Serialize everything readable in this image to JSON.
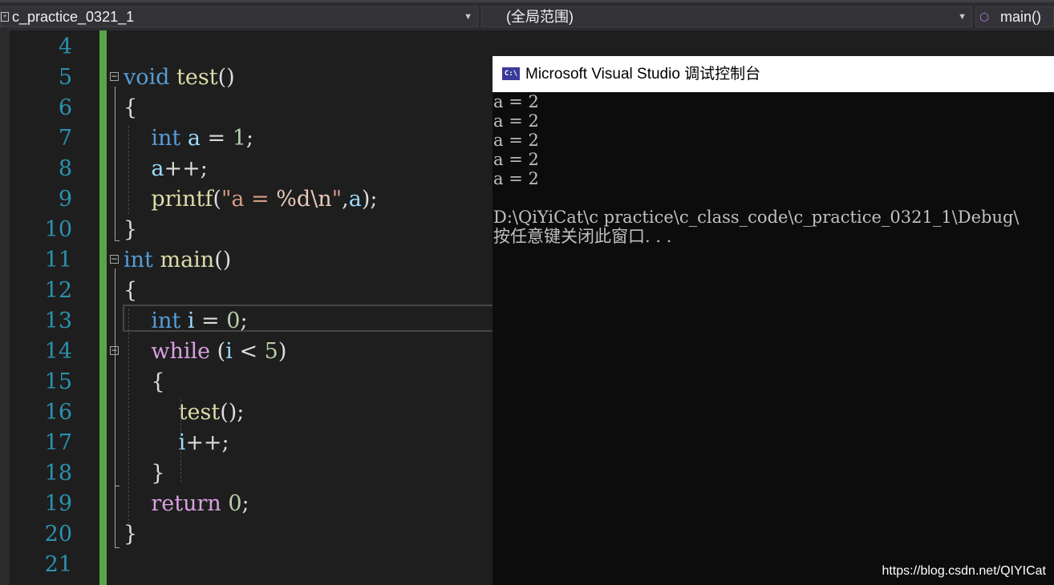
{
  "navbar": {
    "project": "c_practice_0321_1",
    "scope": "(全局范围)",
    "member": "main()"
  },
  "editor": {
    "lines": [
      {
        "num": "4"
      },
      {
        "num": "5",
        "tokens": [
          [
            "kw",
            "void"
          ],
          [
            "plain",
            " "
          ],
          [
            "fn",
            "test"
          ],
          [
            "plain",
            "()"
          ]
        ]
      },
      {
        "num": "6",
        "tokens": [
          [
            "plain",
            "{"
          ]
        ]
      },
      {
        "num": "7",
        "tokens": [
          [
            "plain",
            "    "
          ],
          [
            "kw",
            "int"
          ],
          [
            "plain",
            " "
          ],
          [
            "var",
            "a"
          ],
          [
            "plain",
            " = "
          ],
          [
            "num",
            "1"
          ],
          [
            "plain",
            ";"
          ]
        ]
      },
      {
        "num": "8",
        "tokens": [
          [
            "plain",
            "    "
          ],
          [
            "var",
            "a"
          ],
          [
            "plain",
            "++;"
          ]
        ]
      },
      {
        "num": "9",
        "tokens": [
          [
            "plain",
            "    "
          ],
          [
            "fn",
            "printf"
          ],
          [
            "plain",
            "("
          ],
          [
            "str",
            "\"a = "
          ],
          [
            "esc",
            "%d\\n"
          ],
          [
            "str",
            "\""
          ],
          [
            "plain",
            ","
          ],
          [
            "var",
            "a"
          ],
          [
            "plain",
            ");"
          ]
        ]
      },
      {
        "num": "10",
        "tokens": [
          [
            "plain",
            "}"
          ]
        ]
      },
      {
        "num": "11",
        "tokens": [
          [
            "kw",
            "int"
          ],
          [
            "plain",
            " "
          ],
          [
            "fn",
            "main"
          ],
          [
            "plain",
            "()"
          ]
        ]
      },
      {
        "num": "12",
        "tokens": [
          [
            "plain",
            "{"
          ]
        ]
      },
      {
        "num": "13",
        "tokens": [
          [
            "plain",
            "    "
          ],
          [
            "kw",
            "int"
          ],
          [
            "plain",
            " "
          ],
          [
            "var",
            "i"
          ],
          [
            "plain",
            " = "
          ],
          [
            "num",
            "0"
          ],
          [
            "plain",
            ";"
          ]
        ]
      },
      {
        "num": "14",
        "tokens": [
          [
            "plain",
            "    "
          ],
          [
            "ctl",
            "while"
          ],
          [
            "plain",
            " ("
          ],
          [
            "var",
            "i"
          ],
          [
            "plain",
            " < "
          ],
          [
            "num",
            "5"
          ],
          [
            "plain",
            ")"
          ]
        ]
      },
      {
        "num": "15",
        "tokens": [
          [
            "plain",
            "    {"
          ]
        ]
      },
      {
        "num": "16",
        "tokens": [
          [
            "plain",
            "        "
          ],
          [
            "fn",
            "test"
          ],
          [
            "plain",
            "();"
          ]
        ]
      },
      {
        "num": "17",
        "tokens": [
          [
            "plain",
            "        "
          ],
          [
            "var",
            "i"
          ],
          [
            "plain",
            "++;"
          ]
        ]
      },
      {
        "num": "18",
        "tokens": [
          [
            "plain",
            "    }"
          ]
        ]
      },
      {
        "num": "19",
        "tokens": [
          [
            "plain",
            "    "
          ],
          [
            "ctl",
            "return"
          ],
          [
            "plain",
            " "
          ],
          [
            "num",
            "0"
          ],
          [
            "plain",
            ";"
          ]
        ]
      },
      {
        "num": "20",
        "tokens": [
          [
            "plain",
            "}"
          ]
        ]
      },
      {
        "num": "21"
      }
    ]
  },
  "console": {
    "title": "Microsoft Visual Studio 调试控制台",
    "icon_label": "C:\\",
    "output": [
      "a = 2",
      "a = 2",
      "a = 2",
      "a = 2",
      "a = 2",
      "",
      "D:\\QiYiCat\\c practice\\c_class_code\\c_practice_0321_1\\Debug\\",
      "按任意键关闭此窗口. . ."
    ]
  },
  "watermark": "https://blog.csdn.net/QIYICat",
  "colors": {
    "keyword": "#569cd6",
    "control": "#d8a0df",
    "function": "#dcdcaa",
    "variable": "#9cdcfe",
    "number": "#b5cea8",
    "string": "#d69d85",
    "line_number": "#2b91af",
    "change_bar": "#57a64a"
  }
}
